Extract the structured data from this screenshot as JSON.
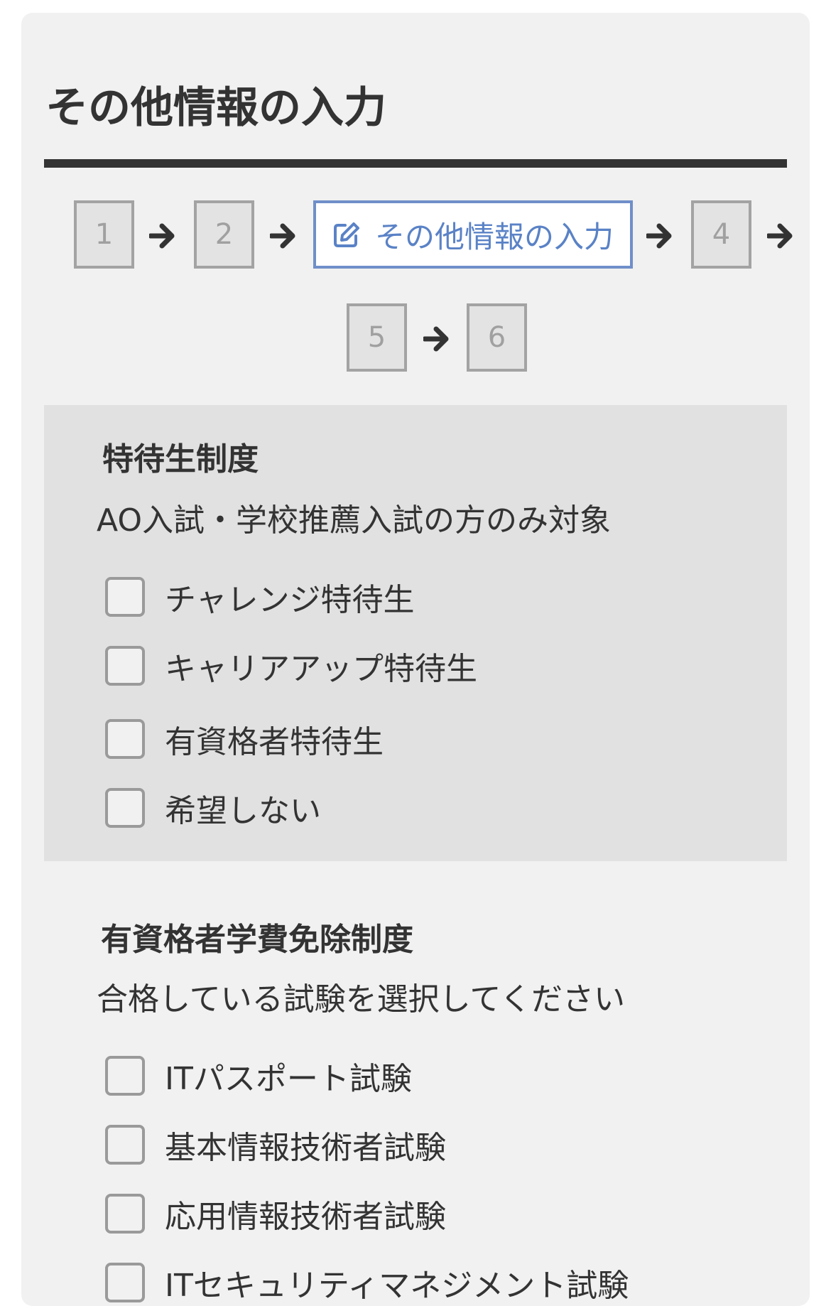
{
  "page_title": "その他情報の入力",
  "steps": {
    "step1": "1",
    "step2": "2",
    "step3_label": "その他情報の入力",
    "step4": "4",
    "step5": "5",
    "step6": "6",
    "active_icon": "pencil-square-icon",
    "arrow_icon": "arrow-right-icon"
  },
  "scholarship": {
    "title": "特待生制度",
    "note": "AO入試・学校推薦入試の方のみ対象",
    "options": [
      {
        "label": "チャレンジ特待生",
        "checked": false
      },
      {
        "label": "キャリアアップ特待生",
        "checked": false
      },
      {
        "label": "有資格者特待生",
        "checked": false
      },
      {
        "label": "希望しない",
        "checked": false
      }
    ]
  },
  "exemption": {
    "title": "有資格者学費免除制度",
    "note": "合格している試験を選択してください",
    "options": [
      {
        "label": "ITパスポート試験",
        "checked": false
      },
      {
        "label": "基本情報技術者試験",
        "checked": false
      },
      {
        "label": "応用情報技術者試験",
        "checked": false
      },
      {
        "label": "ITセキュリティマネジメント試験",
        "checked": false
      }
    ]
  },
  "colors": {
    "accent": "#5a82c6",
    "card_bg": "#f1f1f1",
    "band_bg": "#e1e1e1",
    "text": "#333333"
  }
}
